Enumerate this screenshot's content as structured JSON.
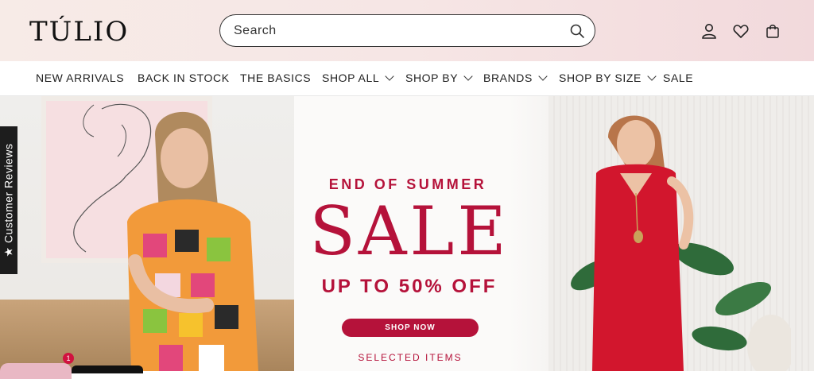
{
  "brand": {
    "logo_text": "TÚLIO"
  },
  "search": {
    "placeholder": "Search"
  },
  "header_icons": [
    "account-icon",
    "wishlist-heart-icon",
    "cart-bag-icon"
  ],
  "nav": {
    "items": [
      {
        "label": "NEW ARRIVALS",
        "dropdown": false
      },
      {
        "label": "BACK IN STOCK",
        "dropdown": false
      },
      {
        "label": "THE BASICS",
        "dropdown": false
      },
      {
        "label": "SHOP ALL",
        "dropdown": true
      },
      {
        "label": "SHOP BY",
        "dropdown": true
      },
      {
        "label": "BRANDS",
        "dropdown": true
      },
      {
        "label": "SHOP BY SIZE",
        "dropdown": true
      },
      {
        "label": "SALE",
        "dropdown": false
      }
    ]
  },
  "hero": {
    "kicker": "END OF SUMMER",
    "headline": "SALE",
    "subheadline": "UP TO 50% OFF",
    "cta_label": "SHOP NOW",
    "footnote": "SELECTED ITEMS"
  },
  "reviews_tab": {
    "label": "★ Customer Reviews"
  },
  "chat": {
    "badge_count": "1"
  },
  "colors": {
    "accent": "#b5123a",
    "header_bg": "#f6e6e5"
  }
}
